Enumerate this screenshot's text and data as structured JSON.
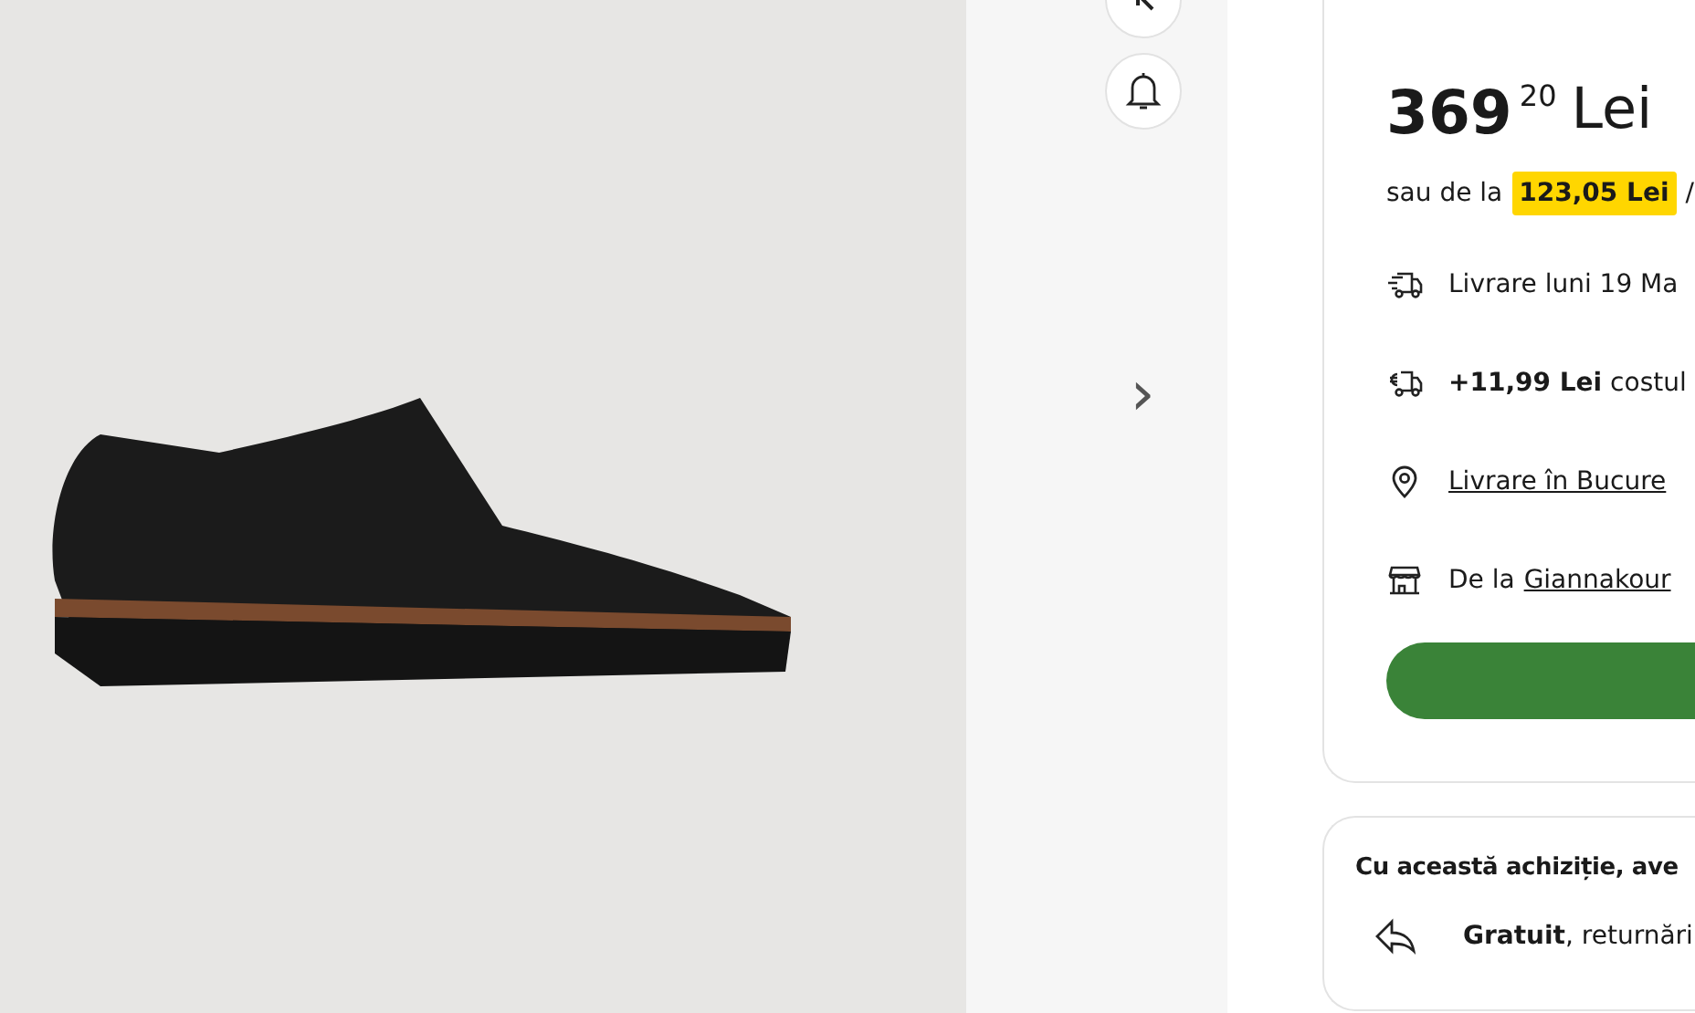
{
  "gallery": {
    "next_arrow": "›"
  },
  "price": {
    "integer": "369",
    "decimals": "20",
    "currency": "Lei"
  },
  "installment": {
    "prefix": "sau de la",
    "amount": "123,05 Lei",
    "suffix": "/"
  },
  "delivery_rows": [
    {
      "kind": "delivery",
      "text": "Livrare luni 19 Ma"
    },
    {
      "kind": "shipping_cost",
      "text": "**+11,99 Lei**  costul"
    },
    {
      "kind": "location",
      "link": "Livrare în Bucure"
    },
    {
      "kind": "seller",
      "text": "De la",
      "link": "Giannakour"
    }
  ],
  "benefits": {
    "title": "Cu această achiziție, ave",
    "items": [
      {
        "text": "**Gratuit**, returnări"
      }
    ]
  }
}
